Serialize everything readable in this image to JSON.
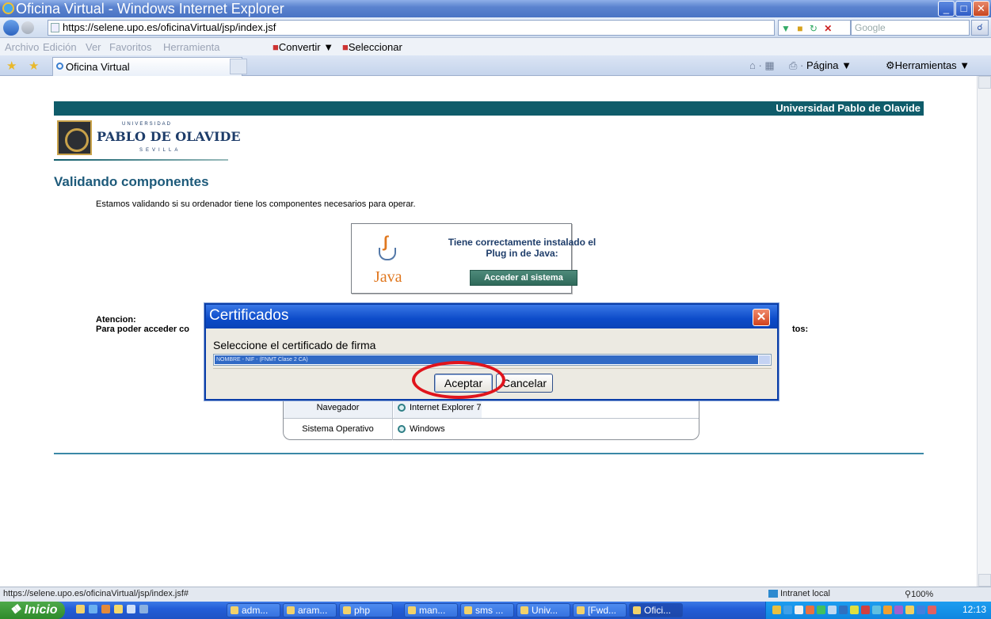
{
  "window": {
    "title": "Oficina Virtual - Windows Internet Explorer"
  },
  "address": {
    "url": "https://selene.upo.es/oficinaVirtual/jsp/index.jsf",
    "search_placeholder": "Google"
  },
  "menu": {
    "items": [
      "Archivo",
      "Edición",
      "Ver",
      "Favoritos",
      "Herramienta"
    ],
    "convertir": "Convertir",
    "seleccionar": "Seleccionar"
  },
  "tab": {
    "label": "Oficina Virtual"
  },
  "commands": {
    "pagina": "Página",
    "herramientas": "Herramientas"
  },
  "page": {
    "university_bar": "Universidad Pablo de Olavide",
    "logo": {
      "top": "UNIVERSIDAD",
      "name": "PABLO DE OLAVIDE",
      "bottom": "SEVILLA"
    },
    "heading": "Validando componentes",
    "intro": "Estamos validando si su ordenador tiene los componentes necesarios para operar.",
    "java": {
      "word": "Java",
      "line1": "Tiene correctamente instalado el",
      "line2": "Plug in de Java:",
      "button": "Acceder al sistema"
    },
    "attention_title": "Atencion:",
    "attention_line": "Para poder acceder co",
    "attention_tail": "tos:",
    "requirements": [
      {
        "key": "Navegador",
        "value": "Internet Explorer 7"
      },
      {
        "key": "Sistema Operativo",
        "value": "Windows"
      }
    ]
  },
  "dialog": {
    "title": "Certificados",
    "prompt": "Seleccione el certificado de firma",
    "selected_item": "NOMBRE                              - NIF              - (FNMT Clase 2 CA)",
    "accept": "Aceptar",
    "cancel": "Cancelar"
  },
  "status": {
    "url": "https://selene.upo.es/oficinaVirtual/jsp/index.jsf#",
    "zone": "Intranet local",
    "zoom": "100%"
  },
  "taskbar": {
    "start": "Inicio",
    "tasks": [
      "adm...",
      "aram...",
      "php",
      "man...",
      "sms ...",
      "Univ...",
      "[Fwd...",
      "Ofici..."
    ],
    "clock": "12:13"
  },
  "colors": {
    "accent": "#0f5c6a",
    "dialog_title": "#0c4bc9",
    "highlight": "#e0141c"
  }
}
